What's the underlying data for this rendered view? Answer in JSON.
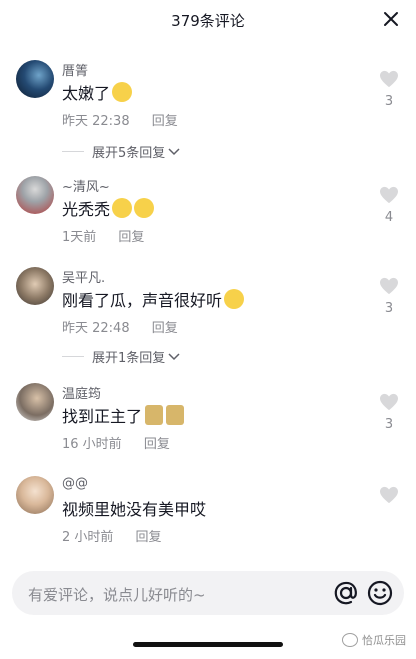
{
  "header": {
    "title": "379条评论"
  },
  "comments": [
    {
      "user": "厝箐",
      "text": "太嫩了",
      "time": "昨天 22:38",
      "reply_label": "回复",
      "likes": "3",
      "expand_label": "展开5条回复"
    },
    {
      "user": "~清风~",
      "text": "光秃秃",
      "time": "1天前",
      "reply_label": "回复",
      "likes": "4"
    },
    {
      "user": "吴平凡.",
      "text": "刚看了瓜，声音很好听",
      "time": "昨天 22:48",
      "reply_label": "回复",
      "likes": "3",
      "expand_label": "展开1条回复"
    },
    {
      "user": "温庭筠",
      "text": "找到正主了",
      "time": "16 小时前",
      "reply_label": "回复",
      "likes": "3"
    },
    {
      "user": "@@",
      "text": "视频里她没有美甲哎",
      "time": "2 小时前",
      "reply_label": "回复",
      "likes": ""
    }
  ],
  "input": {
    "placeholder": "有爱评论，说点儿好听的~"
  },
  "watermark": {
    "text": "恰瓜乐园"
  },
  "icons": [
    "close-icon",
    "heart-icon",
    "chevron-down-icon",
    "at-icon",
    "smile-icon"
  ],
  "colors": {
    "text": "#161823",
    "secondary": "#8a8b91",
    "heart": "#d8d8da"
  }
}
